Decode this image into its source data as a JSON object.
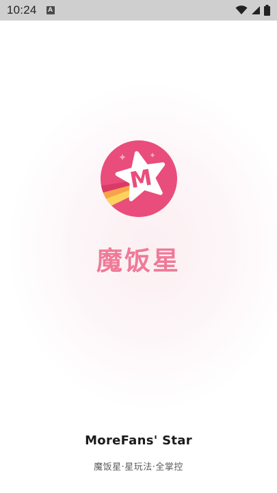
{
  "status_bar": {
    "time": "10:24",
    "notification_badge": "A",
    "icons": [
      "wifi-icon",
      "signal-icon",
      "battery-icon"
    ]
  },
  "splash": {
    "app_name": "魔饭星",
    "brand_en": "MoreFans' Star",
    "tagline": "魔饭星·星玩法·全掌控",
    "logo_letter": "M",
    "colors": {
      "brand_pink": "#e94d7b",
      "logo_star": "#ffffff",
      "app_name_pink": "#f07a98",
      "stripe_orange": "#f8a24a",
      "stripe_yellow": "#fbd35c"
    }
  }
}
